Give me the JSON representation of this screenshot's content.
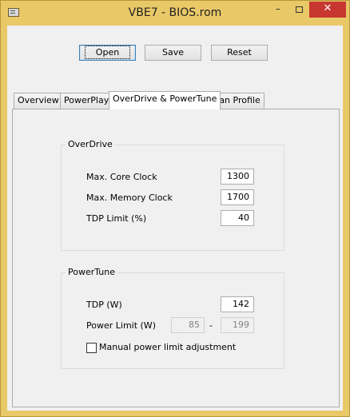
{
  "window": {
    "title": "VBE7 - BIOS.rom",
    "minimize_glyph": "–",
    "close_glyph": "✕"
  },
  "toolbar": {
    "open_label": "Open",
    "save_label": "Save",
    "reset_label": "Reset"
  },
  "tabs": [
    {
      "label": "Overview",
      "active": false
    },
    {
      "label": "PowerPlay",
      "active": false
    },
    {
      "label": "OverDrive & PowerTune",
      "active": true
    },
    {
      "label": "Fan Profile",
      "active": false
    }
  ],
  "overdrive": {
    "title": "OverDrive",
    "core_clock_label": "Max. Core Clock",
    "core_clock_value": "1300",
    "memory_clock_label": "Max. Memory Clock",
    "memory_clock_value": "1700",
    "tdp_limit_label": "TDP Limit (%)",
    "tdp_limit_value": "40"
  },
  "powertune": {
    "title": "PowerTune",
    "tdp_label": "TDP (W)",
    "tdp_value": "142",
    "power_limit_label": "Power Limit (W)",
    "power_limit_min": "85",
    "power_limit_separator": "-",
    "power_limit_max": "199",
    "manual_label": "Manual power limit adjustment",
    "manual_checked": false
  }
}
